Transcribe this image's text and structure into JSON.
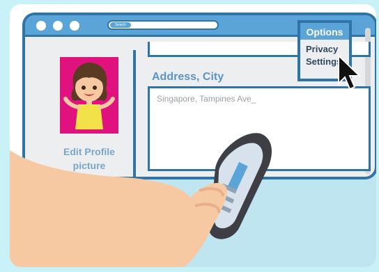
{
  "window": {
    "search_label": "Search"
  },
  "profile": {
    "edit_label_line1": "Edit Profile",
    "edit_label_line2": "picture"
  },
  "address": {
    "label": "Address, City",
    "value": "Singapore, Tampines Ave_"
  },
  "options_menu": {
    "title": "Options",
    "items": [
      {
        "label": "Privacy"
      },
      {
        "label": "Settings"
      }
    ]
  },
  "colors": {
    "accent": "#2f74a6",
    "titlebar": "#5aa4d8",
    "avatar_bg": "#e0127e",
    "page_bg": "#c8f1f8"
  },
  "icons": {
    "cursor": "arrow-cursor-icon",
    "window_buttons": [
      "window-dot-icon",
      "window-dot-icon",
      "window-dot-icon"
    ]
  }
}
